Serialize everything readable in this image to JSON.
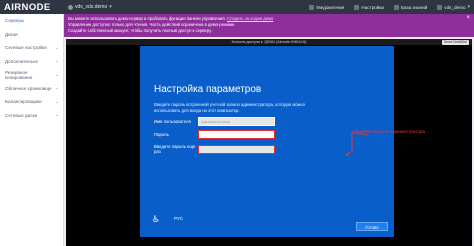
{
  "topbar": {
    "brand": "AIRNODE",
    "server_name": "vds_vds.demo",
    "notifications": "Уведомления",
    "settings": "Настройки",
    "knowledge_base": "База знаний",
    "user": "vds_demo"
  },
  "sidebar": {
    "items": [
      {
        "label": "Серверы",
        "active": true,
        "has_caret": false
      },
      {
        "label": "Диски",
        "active": false,
        "has_caret": false
      },
      {
        "label": "Сетевые настройки",
        "active": false,
        "has_caret": true
      },
      {
        "label": "Дополнительно",
        "active": false,
        "has_caret": true
      },
      {
        "label": "Резервное копирование",
        "active": false,
        "has_caret": true
      },
      {
        "label": "Облачное хранилище",
        "active": false,
        "has_caret": true
      },
      {
        "label": "Балансировщики",
        "active": false,
        "has_caret": true
      },
      {
        "label": "Сетевые диски",
        "active": false,
        "has_caret": true
      }
    ]
  },
  "banner": {
    "line1": "Вы можете использовать демо-сервер и пробовать функции панели управления.",
    "link1": "Следить за ходом демо",
    "line2": "Управление доступно только для чтения. Часть действий ограничена в демо-режиме.",
    "line3": "Создайте собственный аккаунт, чтобы получить полный доступ к серверу.",
    "close": "×"
  },
  "vm": {
    "title": "Консоль доступа к: QEMU (Airnode-VM01/v5)",
    "button": "Send CtrlAltDel"
  },
  "win_setup": {
    "heading": "Настройка параметров",
    "description": "Введите пароль встроенной учетной записи администратора, которую можно использовать для входа на этот компьютер.",
    "username_label": "Имя пользователя",
    "username_placeholder": "Администратор",
    "password_label": "Пароль",
    "password_value": "",
    "confirm_label": "Введите пароль еще раз",
    "confirm_value": "",
    "annotation": "Задайте пароль Администратора",
    "language": "РУС",
    "next_button": "Готово",
    "accessibility_icon": "accessibility-icon"
  },
  "colors": {
    "topbar": "#2f3542",
    "banner": "#8e2f9b",
    "win_blue": "#0a5ec9",
    "accent": "#2f6fd6",
    "annotation": "#e53935"
  }
}
